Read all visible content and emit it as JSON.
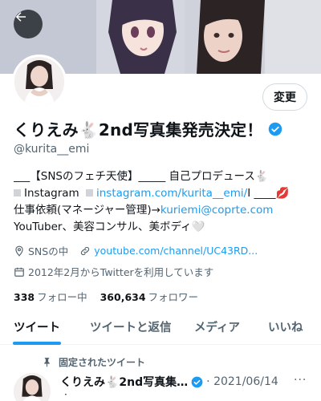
{
  "colors": {
    "accent": "#1d9bf0",
    "text": "#0f1419",
    "muted": "#536471",
    "border": "#cfd9de"
  },
  "header": {
    "back_icon": "arrow-left-icon"
  },
  "profile": {
    "edit_label": "変更",
    "name": "くりえみ🐇2nd写真集発売決定！",
    "handle": "@kurita__emi",
    "bio": {
      "line1": "___【SNSのフェチ天使】_____ 自己プロデュース🐇",
      "line2_prefix": "Instagram",
      "line2_link": "instagram.com/kurita__emi/",
      "line2_suffix": "I ____💋",
      "line3_prefix": "仕事依頼(マネージャー管理)→",
      "line3_link": "kuriemi@coprte.com",
      "line4": "YouTuber、美容コンサル、美ボディ🤍"
    },
    "location": "SNSの中",
    "url": "youtube.com/channel/UC43RD...",
    "joined": "2012年2月からTwitterを利用しています",
    "following_count": "338",
    "following_label": "フォロー中",
    "followers_count": "360,634",
    "followers_label": "フォロワー"
  },
  "tabs": [
    {
      "label": "ツイート"
    },
    {
      "label": "ツイートと返信"
    },
    {
      "label": "メディア"
    },
    {
      "label": "いいね"
    }
  ],
  "pinned_tweet": {
    "pinned_label": "固定されたツイート",
    "author": "くりえみ🐇2nd写真集…",
    "date": "· 2021/06/14",
    "more": "···",
    "dot": "·"
  }
}
